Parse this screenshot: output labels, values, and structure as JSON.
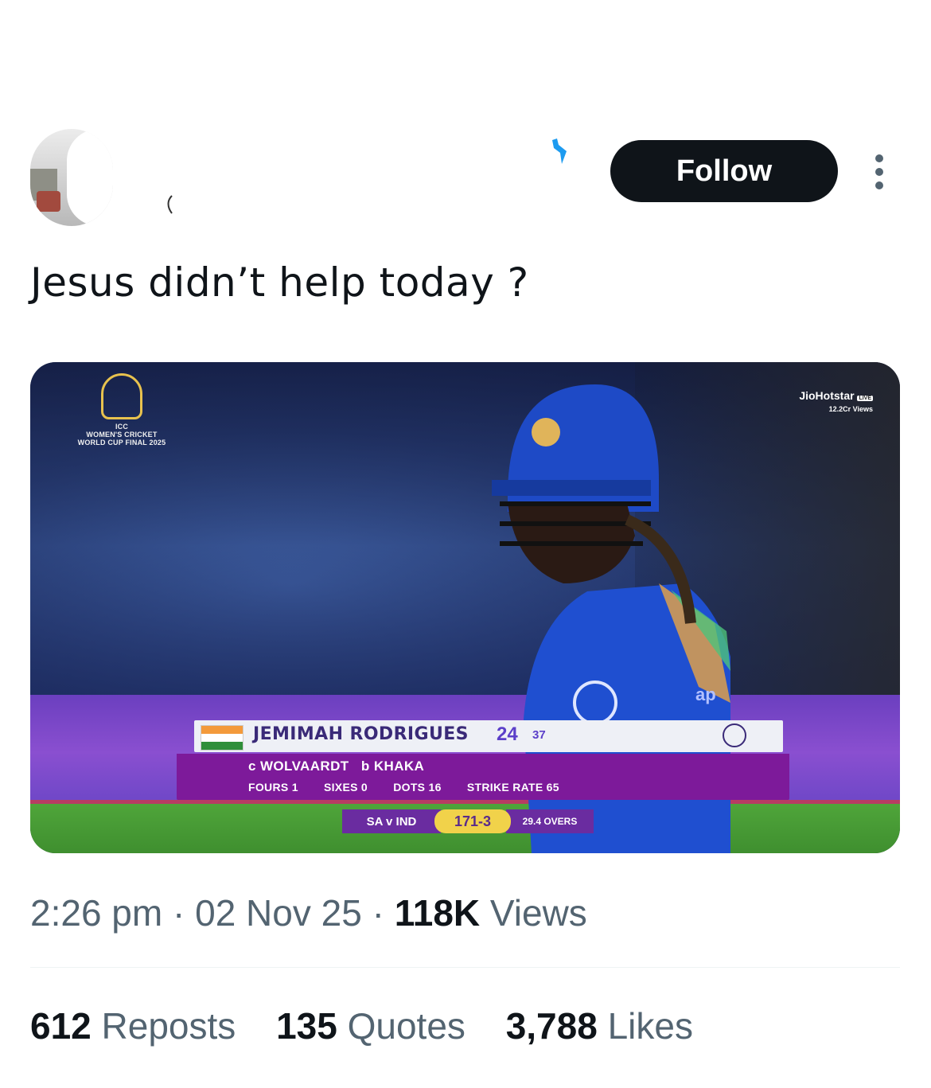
{
  "header": {
    "follow_label": "Follow",
    "more_icon": "more-vertical-icon",
    "verified_icon": "verified-badge-icon"
  },
  "tweet": {
    "text": "Jesus didn’t help today ?"
  },
  "media": {
    "event_logo": "WOMEN'S CRICKET WORLD CUP FINAL 2025",
    "event_logo_icc": "ICC",
    "broadcaster": "JioHotstar",
    "broadcaster_live": "LIVE",
    "viewers": "12.2Cr Views",
    "batter_name": "JEMIMAH RODRIGUES",
    "batter_runs": "24",
    "batter_balls": "37",
    "dismissal_caught": "c",
    "dismissal_fielder": "WOLVAARDT",
    "dismissal_bowled": "b",
    "dismissal_bowler": "KHAKA",
    "fours": "FOURS 1",
    "sixes": "SIXES 0",
    "dots": "DOTS 16",
    "strike_rate": "STRIKE RATE 65",
    "match": "SA v IND",
    "score": "171-3",
    "overs": "29.4 OVERS",
    "sponsor_fragment": "ap"
  },
  "meta": {
    "time": "2:26 pm",
    "sep1": "·",
    "date": "02 Nov 25",
    "sep2": "·",
    "views_count": "118K",
    "views_label": "Views"
  },
  "engagement": {
    "reposts_count": "612",
    "reposts_label": "Reposts",
    "quotes_count": "135",
    "quotes_label": "Quotes",
    "likes_count": "3,788",
    "likes_label": "Likes"
  },
  "colors": {
    "text_primary": "#0f1419",
    "text_secondary": "#536471",
    "follow_bg": "#0f1419",
    "accent_blue": "#1d9bf0"
  }
}
